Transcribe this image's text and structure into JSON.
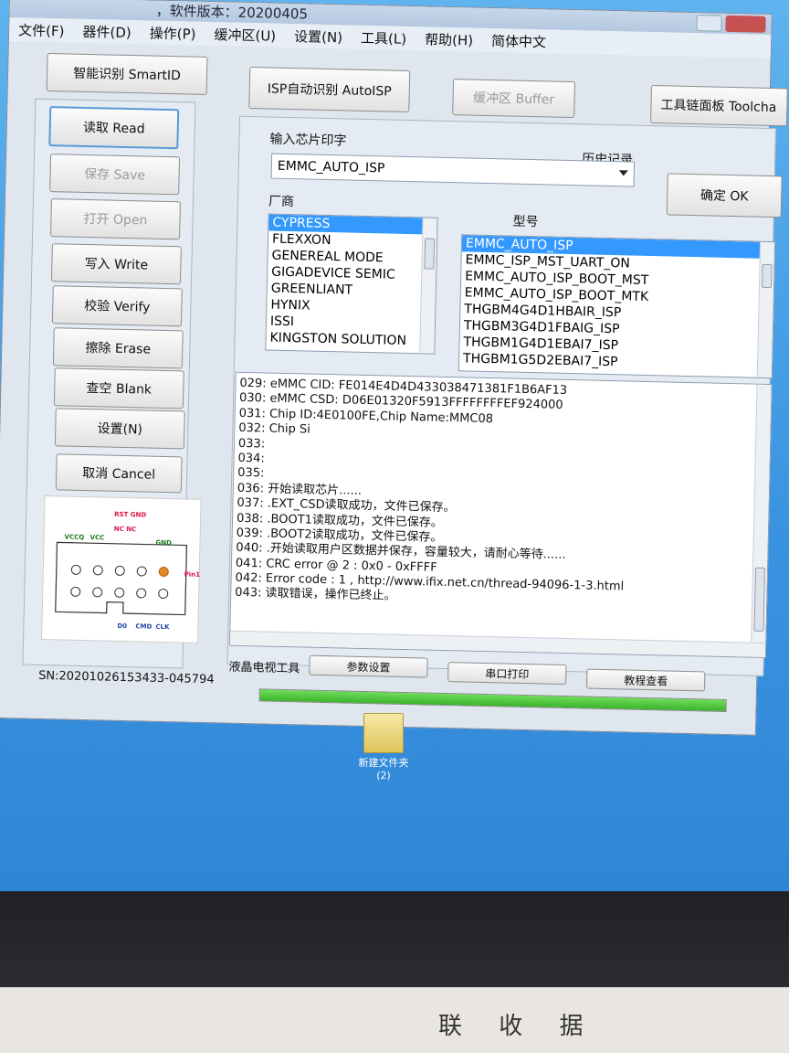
{
  "window": {
    "title": "，软件版本：20200405"
  },
  "menu": [
    "文件(F)",
    "器件(D)",
    "操作(P)",
    "缓冲区(U)",
    "设置(N)",
    "工具(L)",
    "帮助(H)",
    "简体中文"
  ],
  "toolbar": {
    "smartid": "智能识别 SmartID",
    "autoisp": "ISP自动识别 AutoISP",
    "buffer": "缓冲区 Buffer",
    "toolchain": "工具链面板 Toolcha"
  },
  "actions": {
    "read": "读取 Read",
    "save": "保存 Save",
    "open": "打开 Open",
    "write": "写入 Write",
    "verify": "校验 Verify",
    "erase": "擦除 Erase",
    "blank": "查空 Blank",
    "settings": "设置(N)",
    "cancel": "取消 Cancel"
  },
  "chip_input": {
    "label": "输入芯片印字",
    "history_label": "历史记录",
    "value": "EMMC_AUTO_ISP",
    "ok": "确定 OK"
  },
  "vendor": {
    "label": "厂商",
    "items": [
      "CYPRESS",
      "FLEXXON",
      "GENEREAL MODE",
      "GIGADEVICE SEMIC",
      "GREENLIANT",
      "HYNIX",
      "ISSI",
      "KINGSTON SOLUTION"
    ],
    "selected": 0
  },
  "model": {
    "label": "型号",
    "items": [
      "EMMC_AUTO_ISP",
      "EMMC_ISP_MST_UART_ON",
      "EMMC_AUTO_ISP_BOOT_MST",
      "EMMC_AUTO_ISP_BOOT_MTK",
      "THGBM4G4D1HBAIR_ISP",
      "THGBM3G4D1FBAIG_ISP",
      "THGBM1G4D1EBAI7_ISP",
      "THGBM1G5D2EBAI7_ISP"
    ],
    "selected": 0
  },
  "log": [
    "029:  eMMC CID:  FE014E4D4D433038471381F1B6AF13",
    "030:  eMMC CSD: D06E01320F5913FFFFFFFFEF924000",
    "031:  Chip ID:4E0100FE,Chip Name:MMC08",
    "032:  Chip Si",
    "033:",
    "034:",
    "035:",
    "036:  开始读取芯片......",
    "037:  .EXT_CSD读取成功，文件已保存。",
    "038:  .BOOT1读取成功，文件已保存。",
    "039:  .BOOT2读取成功，文件已保存。",
    "040:  .开始读取用户区数据并保存，容量较大，请耐心等待......",
    "041:  CRC error @ 2 : 0x0 - 0xFFFF",
    "042:  Error code : 1 , http://www.ifix.net.cn/thread-94096-1-3.html",
    "043:  读取错误，操作已终止。"
  ],
  "bottom_tools": {
    "label": "液晶电视工具",
    "params": "参数设置",
    "serial": "串口打印",
    "tutorial": "教程查看"
  },
  "diagram": {
    "labels": [
      "VCCQ",
      "VCC",
      "GND",
      "D0",
      "CMD",
      "CLK",
      "Pin1"
    ],
    "colors": {
      "green": "#1a7a1a",
      "red": "#d14",
      "blue": "#2345aa"
    }
  },
  "status": {
    "serial_number": "SN:20201026153433-045794",
    "progress": 1.0
  },
  "desktop": {
    "icon_label": "新建文件夹",
    "icon_sub": "(2)"
  },
  "paper": {
    "text": "联 收 据"
  }
}
